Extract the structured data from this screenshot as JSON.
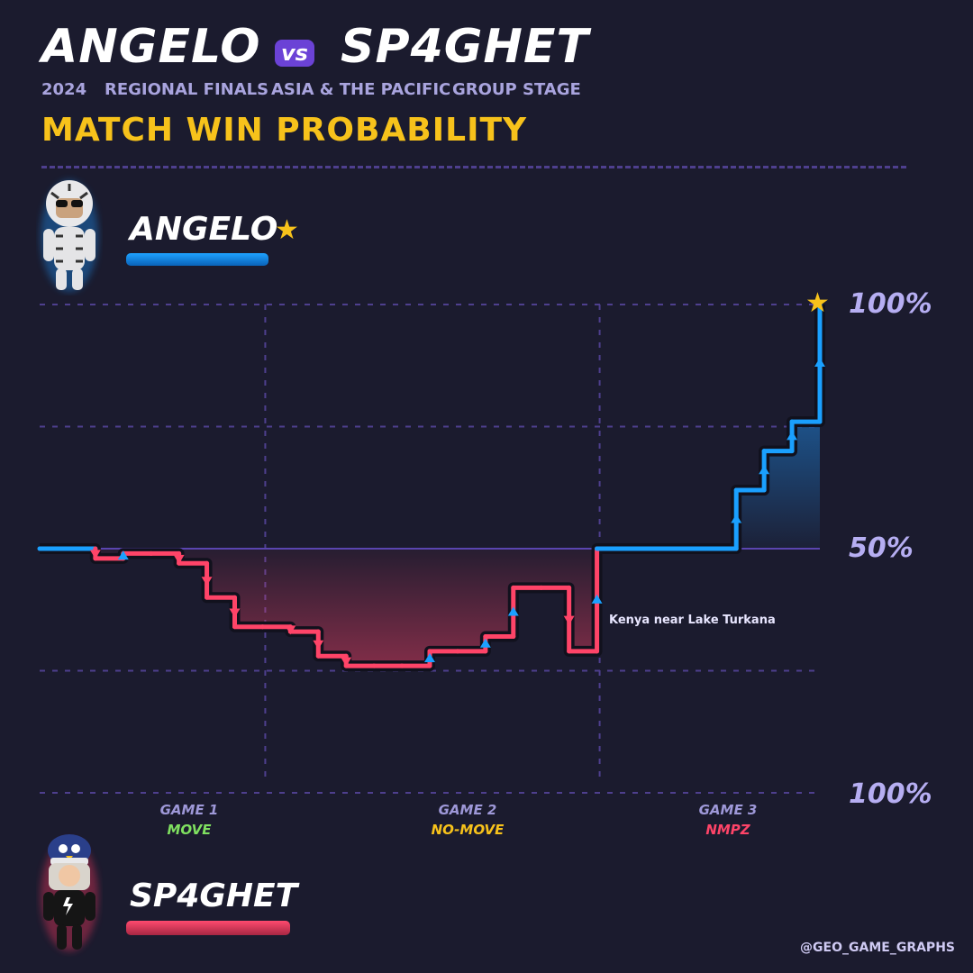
{
  "header": {
    "player_a": "ANGELO",
    "vs": "vs",
    "player_b": "SP4GHET",
    "subtitle": [
      "2024",
      "REGIONAL FINALS",
      "ASIA & THE PACIFIC",
      "GROUP STAGE"
    ],
    "headline": "MATCH WIN PROBABILITY"
  },
  "players": {
    "top": {
      "name": "ANGELO",
      "color": "#1aa0ff",
      "winner_star": "star-icon"
    },
    "bottom": {
      "name": "SP4GHET",
      "color": "#ff4468"
    }
  },
  "axis": {
    "top_label": "100%",
    "mid_label": "50%",
    "bottom_label": "100%"
  },
  "games": [
    {
      "game": "GAME 1",
      "mode": "MOVE",
      "mode_color": "#7fe060"
    },
    {
      "game": "GAME 2",
      "mode": "NO-MOVE",
      "mode_color": "#f7c21b"
    },
    {
      "game": "GAME 3",
      "mode": "NMPZ",
      "mode_color": "#ff4468"
    }
  ],
  "annotation": "Kenya near Lake Turkana",
  "credit": "@GEO_GAME_GRAPHS",
  "chart_data": {
    "type": "line",
    "xlabel": "",
    "ylabel": "",
    "ylim": [
      0,
      100
    ],
    "ytick_labels": [
      "100%",
      "50%",
      "100%"
    ],
    "series": [
      {
        "name": "ANGELO",
        "values": [
          [
            0,
            50
          ],
          [
            1,
            50
          ],
          [
            2,
            48
          ],
          [
            3,
            49
          ],
          [
            4,
            49
          ],
          [
            5,
            47
          ],
          [
            6,
            40
          ],
          [
            7,
            34
          ],
          [
            8,
            34
          ],
          [
            9,
            33
          ],
          [
            10,
            28
          ],
          [
            11,
            26
          ],
          [
            12,
            26
          ],
          [
            13,
            26
          ],
          [
            14,
            29
          ],
          [
            15,
            29
          ],
          [
            16,
            32
          ],
          [
            17,
            42
          ],
          [
            18,
            42
          ],
          [
            19,
            29
          ],
          [
            20,
            50
          ],
          [
            21,
            50
          ],
          [
            22,
            50
          ],
          [
            23,
            50
          ],
          [
            24,
            50
          ],
          [
            25,
            62
          ],
          [
            26,
            70
          ],
          [
            27,
            76
          ],
          [
            28,
            100
          ]
        ]
      }
    ],
    "game_boundaries": [
      8,
      20
    ]
  }
}
